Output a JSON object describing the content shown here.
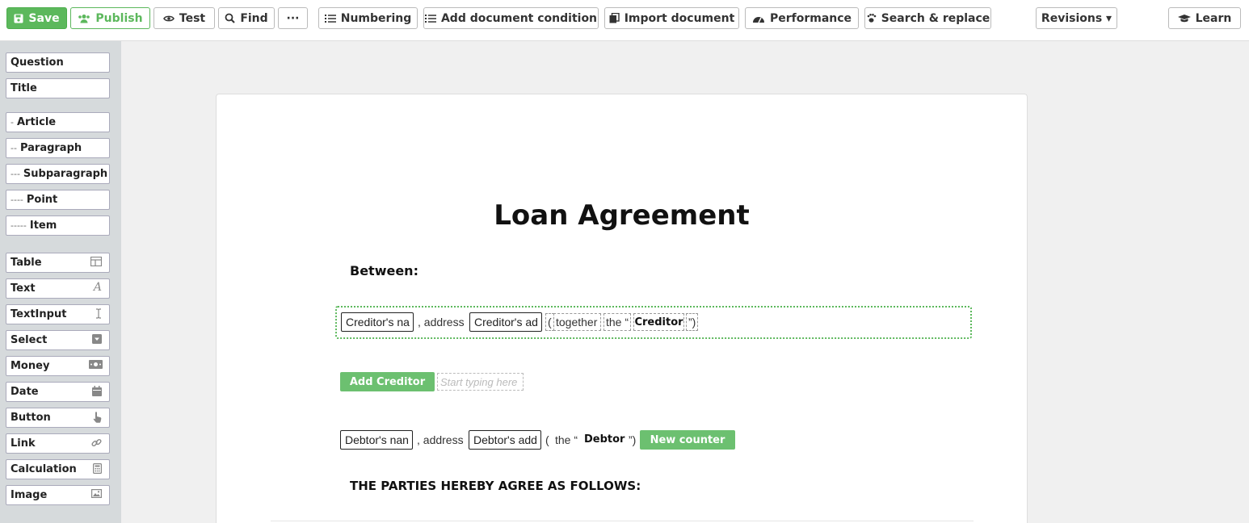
{
  "toolbar": {
    "save": {
      "label": "Save",
      "icon": "floppy-disk-icon"
    },
    "publish": {
      "label": "Publish",
      "icon": "users-icon"
    },
    "test": {
      "label": "Test",
      "icon": "eye-icon"
    },
    "find": {
      "label": "Find",
      "icon": "search-icon"
    },
    "more": {
      "label": "···"
    },
    "numbering": {
      "label": "Numbering",
      "icon": "list-ol-icon"
    },
    "add_condition": {
      "label": "Add document condition",
      "icon": "list-icon"
    },
    "import": {
      "label": "Import document",
      "icon": "copy-icon"
    },
    "performance": {
      "label": "Performance",
      "icon": "tachometer-icon"
    },
    "search_replace": {
      "label": "Search & replace",
      "icon": "paw-icon"
    },
    "revisions": {
      "label": "Revisions ▾"
    },
    "learn": {
      "label": "Learn",
      "icon": "graduation-cap-icon"
    }
  },
  "sidebar": {
    "structure": [
      {
        "prefix": "",
        "label": "Question"
      },
      {
        "prefix": "",
        "label": "Title"
      },
      {
        "prefix": "-",
        "label": "Article"
      },
      {
        "prefix": "--",
        "label": "Paragraph"
      },
      {
        "prefix": "---",
        "label": "Subparagraph"
      },
      {
        "prefix": "----",
        "label": "Point"
      },
      {
        "prefix": "-----",
        "label": "Item"
      }
    ],
    "elements": [
      {
        "label": "Table",
        "icon": "table-icon"
      },
      {
        "label": "Text",
        "icon": "font-icon"
      },
      {
        "label": "TextInput",
        "icon": "text-cursor-icon"
      },
      {
        "label": "Select",
        "icon": "caret-square-down-icon"
      },
      {
        "label": "Money",
        "icon": "money-bill-icon"
      },
      {
        "label": "Date",
        "icon": "calendar-icon"
      },
      {
        "label": "Button",
        "icon": "hand-pointer-icon"
      },
      {
        "label": "Link",
        "icon": "link-icon"
      },
      {
        "label": "Calculation",
        "icon": "calculator-icon"
      },
      {
        "label": "Image",
        "icon": "image-icon"
      }
    ]
  },
  "document": {
    "title": "Loan Agreement",
    "between": "Between:",
    "creditor": {
      "name_field": "Creditor's na",
      "address_text": ", address",
      "address_field": "Creditor's ad",
      "open_paren": "(",
      "together": "together",
      "the": "the “",
      "label": "Creditor",
      "close": "”)"
    },
    "add_creditor": "Add Creditor",
    "placeholder": "Start typing here",
    "debtor": {
      "name_field": "Debtor's nan",
      "address_text": ", address",
      "address_field": "Debtor's add",
      "open": "(",
      "the": "the “",
      "label": "Debtor",
      "close": "”)"
    },
    "new_counter": "New counter",
    "agree": "THE PARTIES HEREBY AGREE AS FOLLOWS:"
  },
  "colors": {
    "accent_green": "#5cb85c",
    "sidebar_bg": "#d6dadc"
  }
}
